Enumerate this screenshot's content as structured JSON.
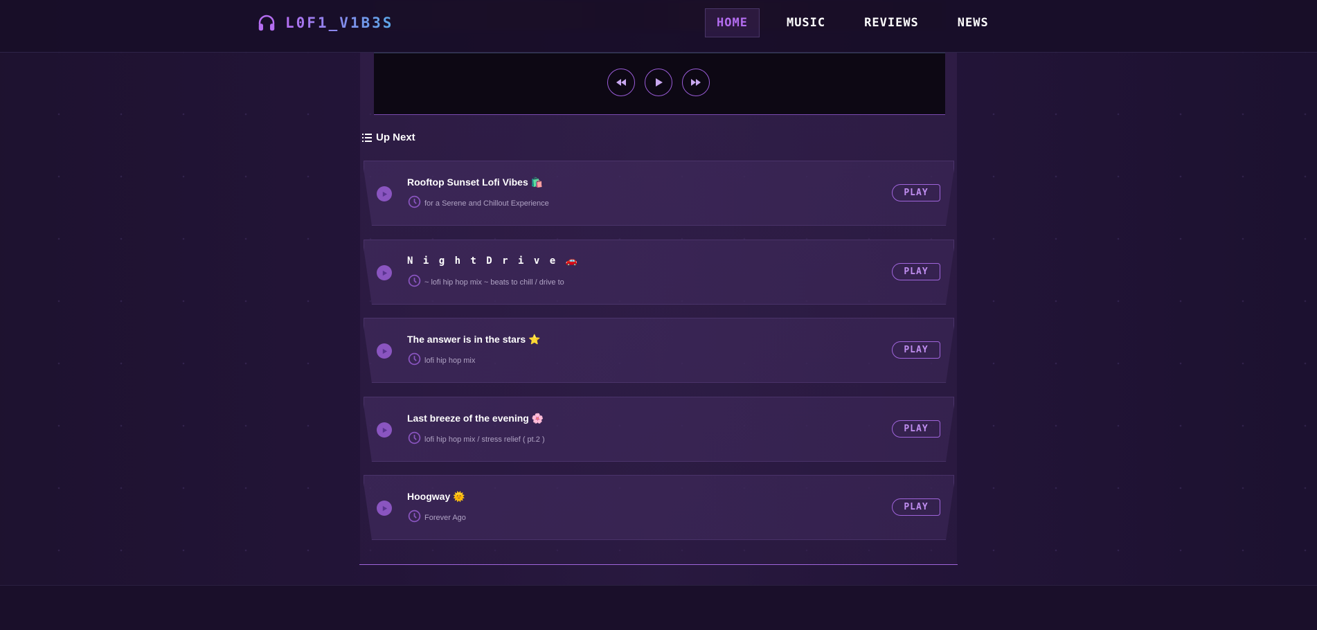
{
  "brand": {
    "name": "L0F1_V1B3S",
    "icon": "headphones-icon",
    "accent": "#b46df0",
    "accent2": "#5aa8e8"
  },
  "nav": {
    "items": [
      {
        "label": "HOME",
        "active": true
      },
      {
        "label": "MUSIC",
        "active": false
      },
      {
        "label": "REVIEWS",
        "active": false
      },
      {
        "label": "NEWS",
        "active": false
      }
    ]
  },
  "player": {
    "controls": [
      "rewind-icon",
      "play-icon",
      "fast-forward-icon"
    ]
  },
  "up_next": {
    "heading": "Up Next",
    "icon": "list-icon",
    "tracks": [
      {
        "title": "Rooftop Sunset Lofi Vibes 🛍️",
        "subtitle": "for a Serene and Chillout Experience",
        "button": "PLAY"
      },
      {
        "title": "N i g h t  D r i v e  🚗",
        "subtitle": "~ lofi hip hop mix ~ beats to chill / drive to",
        "button": "PLAY"
      },
      {
        "title": "The answer is in the stars ⭐",
        "subtitle": "lofi hip hop mix",
        "button": "PLAY"
      },
      {
        "title": "Last breeze of the evening 🌸",
        "subtitle": "lofi hip hop mix / stress relief ( pt.2 )",
        "button": "PLAY"
      },
      {
        "title": "Hoogway 🌞",
        "subtitle": "Forever Ago",
        "button": "PLAY"
      }
    ]
  }
}
